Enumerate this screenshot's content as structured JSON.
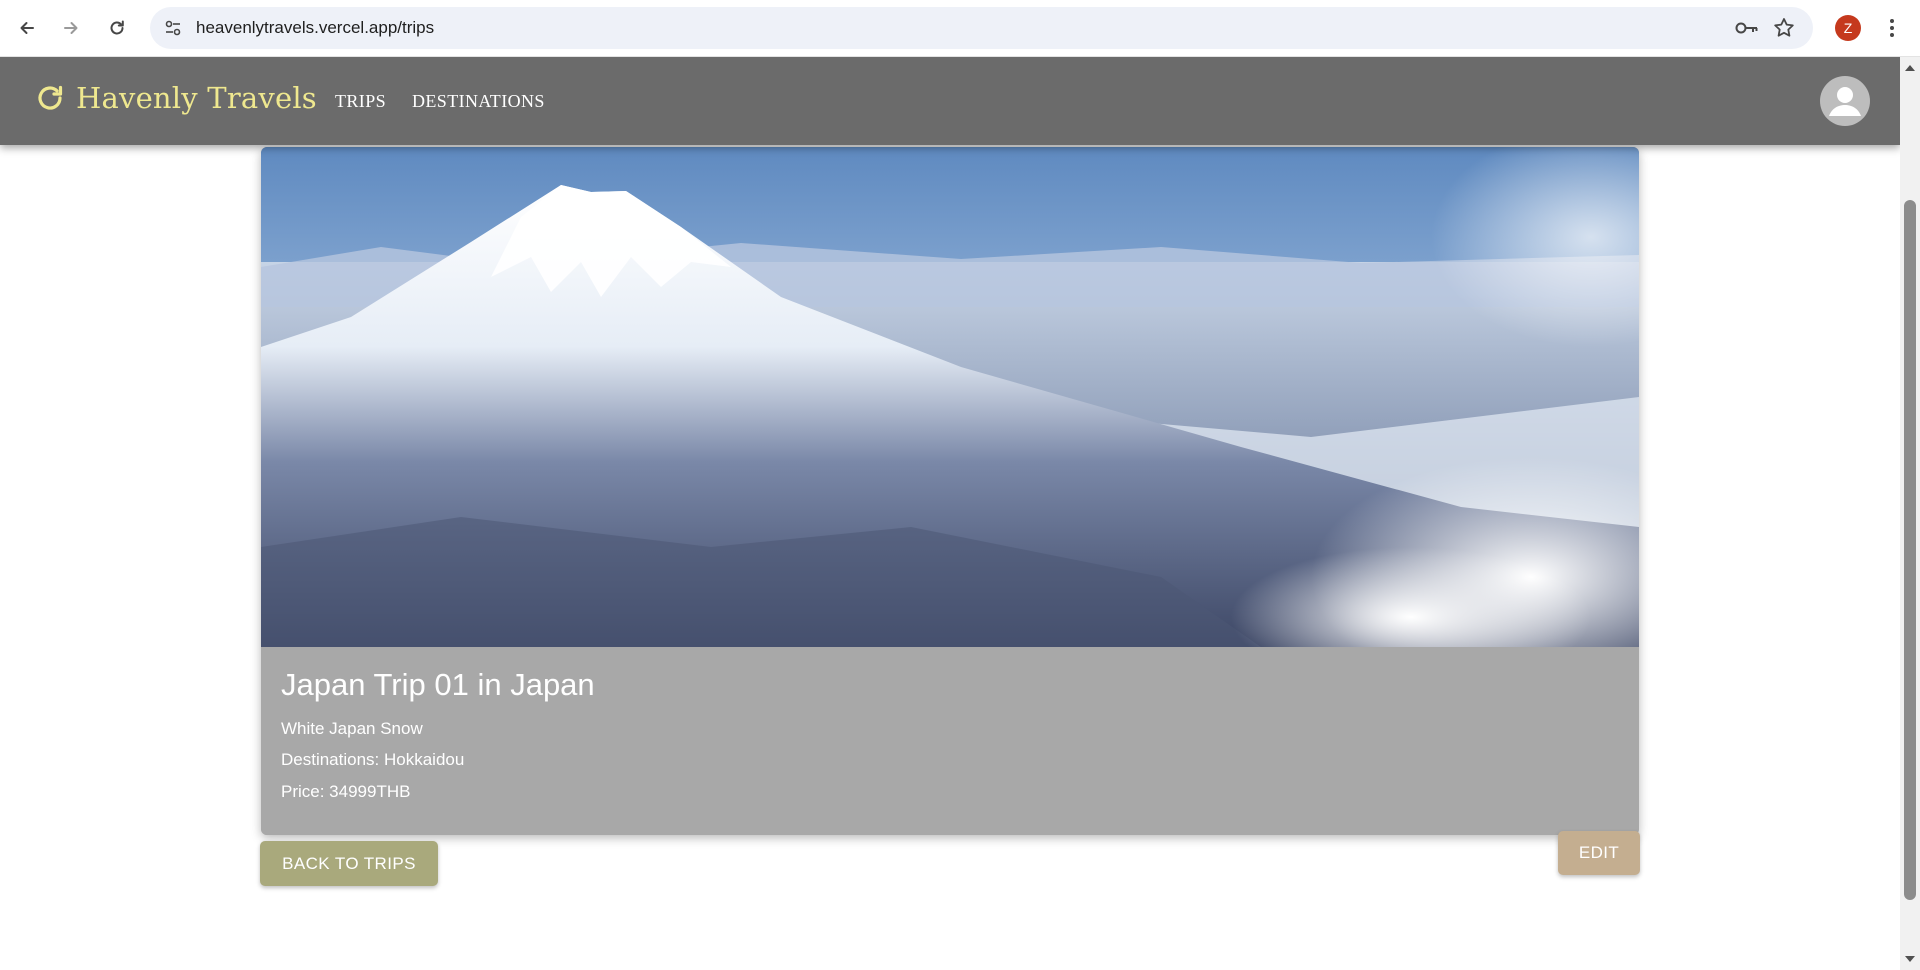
{
  "browser": {
    "url": "heavenlytravels.vercel.app/trips",
    "profile_initial": "Z"
  },
  "app": {
    "brand": "Havenly Travels",
    "nav": [
      "TRIPS",
      "DESTINATIONS"
    ],
    "colors": {
      "appbar": "#6b6b6b",
      "brand": "#efe88f"
    }
  },
  "trip": {
    "title": "Japan Trip 01 in Japan",
    "description": "White Japan Snow",
    "destinations": "Destinations: Hokkaidou",
    "price": "Price: 34999THB",
    "image_alt": "Snow-covered volcano in Hokkaido"
  },
  "actions": {
    "back": "BACK TO TRIPS",
    "edit": "EDIT"
  }
}
